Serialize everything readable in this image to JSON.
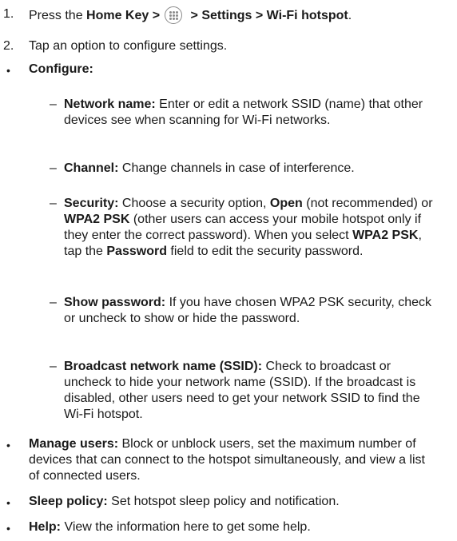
{
  "steps": [
    {
      "num": "1.",
      "parts": [
        {
          "t": "Press the ",
          "b": false
        },
        {
          "t": "Home Key >",
          "b": true
        },
        {
          "icon": "apps-icon"
        },
        {
          "t": " > Settings > Wi-Fi hotspot",
          "b": true
        },
        {
          "t": ".",
          "b": false
        }
      ]
    },
    {
      "num": "2.",
      "parts": [
        {
          "t": "Tap an option to configure settings.",
          "b": false
        }
      ]
    }
  ],
  "configure": {
    "bullet": "•",
    "label": "Configure:",
    "subitems": [
      {
        "dash": "–",
        "label": "Network name:",
        "text": " Enter or edit a network SSID (name) that other devices see when scanning for Wi-Fi networks."
      },
      {
        "dash": "–",
        "label": "Channel:",
        "text": " Change channels in case of interference."
      },
      {
        "dash": "–",
        "parts": [
          {
            "t": "Security:",
            "b": true
          },
          {
            "t": " Choose a security option, ",
            "b": false
          },
          {
            "t": "Open",
            "b": true
          },
          {
            "t": " (not recommended) or ",
            "b": false
          },
          {
            "t": "WPA2 PSK",
            "b": true
          },
          {
            "t": " (other users can access your mobile hotspot only if they enter the correct password). When you select ",
            "b": false
          },
          {
            "t": "WPA2 PSK",
            "b": true
          },
          {
            "t": ", tap the ",
            "b": false
          },
          {
            "t": "Password",
            "b": true
          },
          {
            "t": " field to edit the security password.",
            "b": false
          }
        ]
      },
      {
        "dash": "–",
        "label": "Show password:",
        "text": " If you have chosen WPA2 PSK security, check or uncheck to show or hide the password."
      },
      {
        "dash": "–",
        "label": "Broadcast network name (SSID):",
        "text": " Check to broadcast or uncheck to hide your network name (SSID). If the broadcast is disabled, other users need to get your network SSID to find the Wi-Fi hotspot."
      }
    ]
  },
  "bullets": [
    {
      "bullet": "•",
      "label": "Manage users:",
      "text": " Block or unblock users, set the maximum number of devices that can connect to the hotspot simultaneously, and view a list of connected users."
    },
    {
      "bullet": "•",
      "label": "Sleep policy:",
      "text": " Set hotspot sleep policy and notification."
    },
    {
      "bullet": "•",
      "label": "Help:",
      "text": " View the information here to get some help."
    }
  ],
  "colors": {
    "text": "#1a1a1a",
    "icon": "#8a8a8a"
  }
}
